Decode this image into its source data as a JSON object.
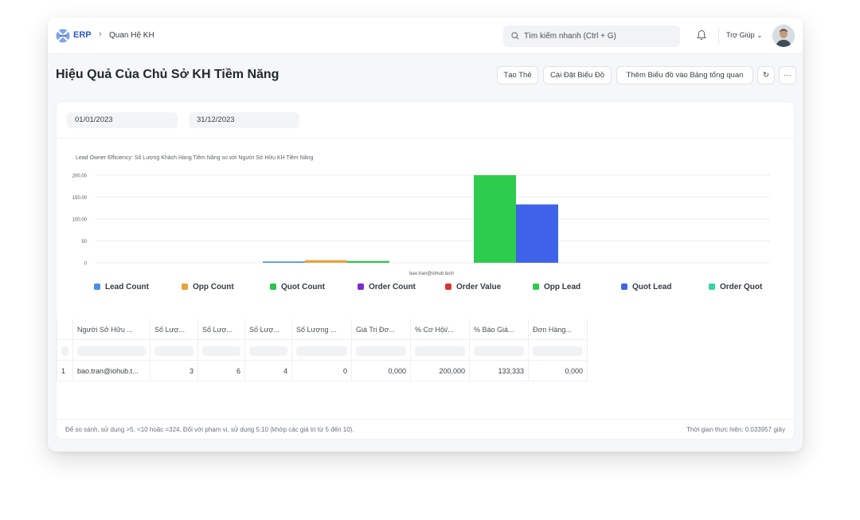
{
  "navbar": {
    "brand": "ERP",
    "breadcrumb_sep": "›",
    "breadcrumb": "Quan Hệ KH",
    "search_placeholder": "Tìm kiếm nhanh (Ctrl + G)",
    "help_label": "Trợ Giúp ⌄"
  },
  "page": {
    "title": "Hiệu Quả Của Chủ Sở KH Tiềm Năng",
    "actions": {
      "create_card": "Tạo Thẻ",
      "chart_settings": "Cài Đặt Biểu Đồ",
      "add_to_dashboard": "Thêm Biểu đồ vào Bảng tổng quan",
      "refresh": "↻",
      "more": "···"
    }
  },
  "filters": {
    "from_date": "01/01/2023",
    "to_date": "31/12/2023"
  },
  "chart_data": {
    "type": "bar",
    "title": "Lead Owner Efficiency: Số Lượng Khách Hàng Tiềm Năng so với Người Sở Hữu KH Tiềm Năng",
    "categories": [
      "bao.tran@iohub.tech"
    ],
    "ylim": [
      0,
      200
    ],
    "y_ticks": [
      "0",
      "50",
      "100.00",
      "150.00",
      "200.00"
    ],
    "series": [
      {
        "name": "Lead Count",
        "color": "#4c8fe0",
        "values": [
          3
        ]
      },
      {
        "name": "Opp Count",
        "color": "#e9a23b",
        "values": [
          6
        ]
      },
      {
        "name": "Quot Count",
        "color": "#2bc54f",
        "values": [
          4
        ]
      },
      {
        "name": "Order Count",
        "color": "#7c2bd0",
        "values": [
          0
        ]
      },
      {
        "name": "Order Value",
        "color": "#d93535",
        "values": [
          0
        ]
      },
      {
        "name": "Opp Lead",
        "color": "#2ecc4e",
        "values": [
          200
        ]
      },
      {
        "name": "Quot Lead",
        "color": "#3f63e8",
        "values": [
          133.333
        ]
      },
      {
        "name": "Order Quot",
        "color": "#34d6a6",
        "values": [
          0
        ]
      }
    ],
    "grid": true,
    "legend_position": "bottom"
  },
  "report": {
    "columns": [
      "Người Sở Hữu ...",
      "Số Lượ...",
      "Số Lượ...",
      "Số Lượ...",
      "Số Lượng ...",
      "Giá Trị Đơ...",
      "% Cơ Hội/...",
      "% Báo Giá...",
      "Đơn Hàng..."
    ],
    "rows": [
      {
        "index": "1",
        "cells": [
          "bao.tran@iohub.t...",
          "3",
          "6",
          "4",
          "0",
          "0,000",
          "200,000",
          "133,333",
          "0,000"
        ]
      }
    ]
  },
  "footer": {
    "hint": "Để so sánh, sử dụng >5, <10 hoặc =324. Đối với phạm vi, sử dụng 5:10 (khớp các giá trị từ 5 đến 10).",
    "exec_time": "Thời gian thực hiện: 0.033957 giây"
  }
}
